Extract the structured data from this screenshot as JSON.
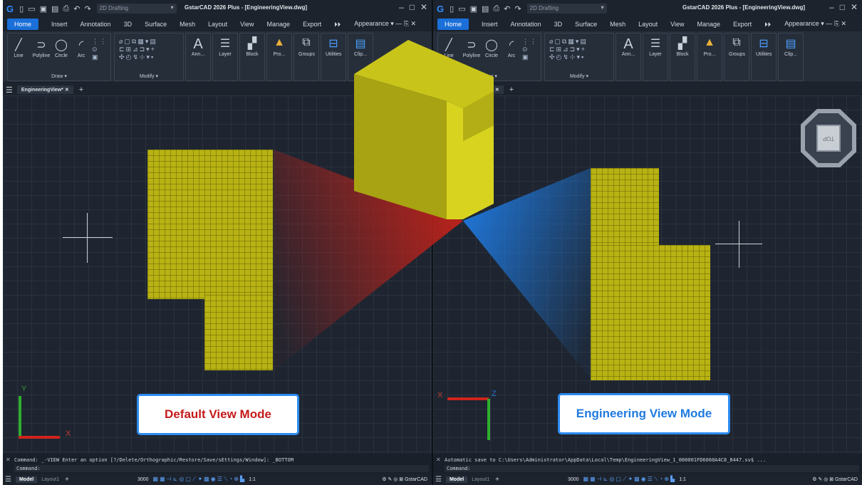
{
  "app": {
    "title": "GstarCAD 2026 Plus - [EngineeringView.dwg]",
    "workspace": "2D Drafting"
  },
  "ribbon_tabs": [
    "Home",
    "Insert",
    "Annotation",
    "3D",
    "Surface",
    "Mesh",
    "Layout",
    "View",
    "Manage",
    "Export"
  ],
  "appearance_label": "Appearance",
  "ribbon": {
    "draw": {
      "label": "Draw",
      "tools": [
        "Line",
        "Polyline",
        "Circle",
        "Arc"
      ]
    },
    "modify": {
      "label": "Modify"
    },
    "annotation": "Ann...",
    "layer": "Layer",
    "block": "Block",
    "properties": "Pro...",
    "groups": "Groups",
    "utilities": "Utilities",
    "clipboard": "Clip..."
  },
  "doc_tab": "EngineeringView*",
  "left_pane": {
    "mode_label": "Default View Mode",
    "mode_color": "#c41a1a",
    "cmd_line1": "Command: _-VIEW Enter an option [?/Delete/Orthographic/Restore/Save/sEttings/Window]: _BOTTOM",
    "cmd_line2": "Command:",
    "axis_y": "Y",
    "axis_x": "X"
  },
  "right_pane": {
    "mode_label": "Engineering View Mode",
    "mode_color": "#1f7ae0",
    "cmd_line1": "Automatic save to C:\\Users\\Administrator\\AppData\\Local\\Temp\\EngineeringView_1_000001FD6060A4C8_8447.sv$ ...",
    "cmd_line2": "Command:",
    "axis_x": "X",
    "axis_z": "Z",
    "viewcube_top": "TOP"
  },
  "status": {
    "model": "Model",
    "layout": "Layout1",
    "grid_value": "3000",
    "scale": "1:1",
    "brand": "GstarCAD"
  },
  "colors": {
    "shape": "#b8b214",
    "beam_red": "#c0221a",
    "beam_blue": "#1f7ae0",
    "accent": "#1a6fd8"
  }
}
